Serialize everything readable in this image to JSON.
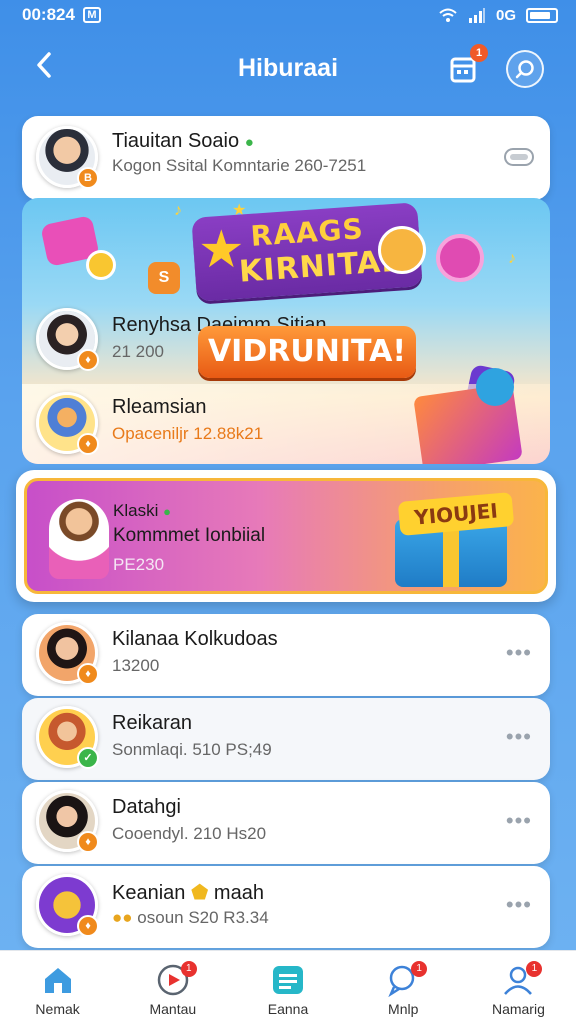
{
  "status_bar": {
    "time": "00:824",
    "battery_text": "0G"
  },
  "header": {
    "title": "Hiburaai",
    "calendar_badge": "1"
  },
  "top_card": {
    "name": "Tiauitan Soaio",
    "subtitle": "Kogon Ssital Komntarie 260-7251"
  },
  "promo": {
    "badge_line1": "RAAGS",
    "badge_line2": "KIRNITAL",
    "cta": "VIDRUNITA!",
    "rows": [
      {
        "name": "Renyhsa Daeimm Sitian",
        "subtitle": "21 200"
      },
      {
        "name": "Rleamsian",
        "subtitle": "Opaceniljr 12.88k21"
      }
    ]
  },
  "highlight": {
    "name": "Klaski",
    "line2": "Kommmet Ionbiial",
    "value": "PE230",
    "tag": "YIOUJEI"
  },
  "list": [
    {
      "name": "Kilanaa Kolkudoas",
      "subtitle": "13200"
    },
    {
      "name": "Reikaran",
      "subtitle": "Sonmlaqi. 510 PS;49"
    },
    {
      "name": "Datahgi",
      "subtitle": "Cooendyl. 210 Hs20"
    },
    {
      "name": "Keanian",
      "name_suffix": "maah",
      "subtitle": "osoun S20 R3.34"
    }
  ],
  "nav": [
    {
      "label": "Nemak",
      "icon": "home-icon",
      "badge": ""
    },
    {
      "label": "Mantau",
      "icon": "play-icon",
      "badge": "1"
    },
    {
      "label": "Eanna",
      "icon": "calendar-icon",
      "badge": ""
    },
    {
      "label": "Mnlp",
      "icon": "chat-icon",
      "badge": "1"
    },
    {
      "label": "Namarig",
      "icon": "profile-icon",
      "badge": "1"
    }
  ],
  "colors": {
    "accent_blue": "#3f8fe8",
    "badge_orange": "#f05a28",
    "promo_orange": "#e85a14",
    "promo_purple": "#6a2ba4"
  }
}
